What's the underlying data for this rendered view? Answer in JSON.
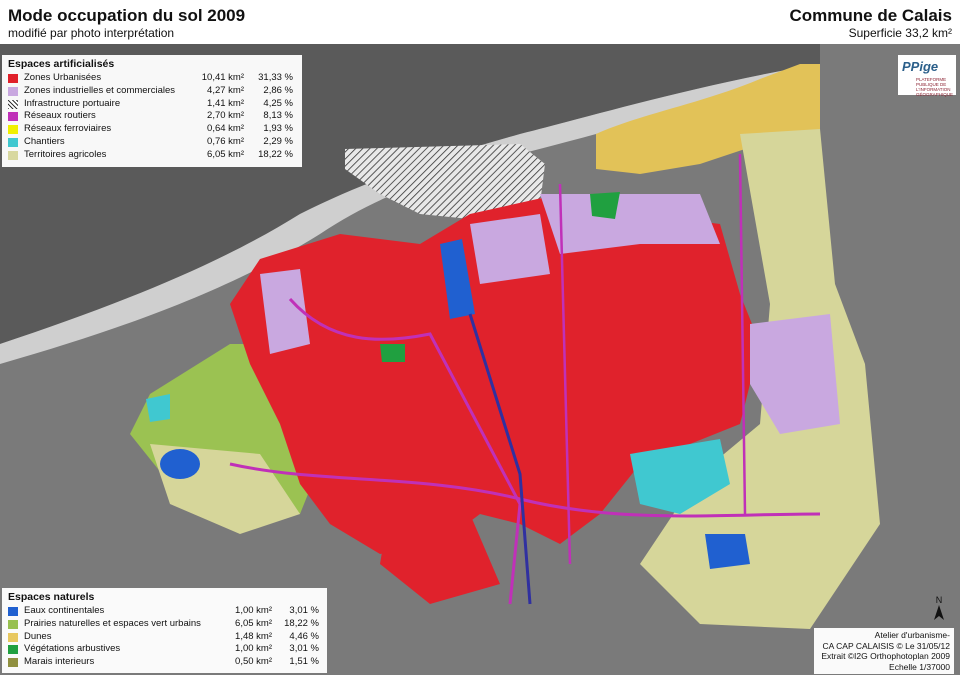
{
  "header": {
    "title": "Mode occupation du sol 2009",
    "subtitle": "modifié par photo interprétation",
    "commune": "Commune de Calais",
    "superficie": "Superficie 33,2 km²"
  },
  "legend_artificial": {
    "heading": "Espaces artificialisés",
    "items": [
      {
        "label": "Zones Urbanisées",
        "area": "10,41 km²",
        "percent": "31,33 %",
        "color": "#e0202a"
      },
      {
        "label": "Zones industrielles et commerciales",
        "area": "4,27 km²",
        "percent": "2,86 %",
        "color": "#c9a8e0"
      },
      {
        "label": "Infrastructure portuaire",
        "area": "1,41 km²",
        "percent": "4,25 %",
        "color": "hatch"
      },
      {
        "label": "Réseaux routiers",
        "area": "2,70 km²",
        "percent": "8,13 %",
        "color": "#c030b8"
      },
      {
        "label": "Réseaux ferroviaires",
        "area": "0,64 km²",
        "percent": "1,93 %",
        "color": "#f0f000"
      },
      {
        "label": "Chantiers",
        "area": "0,76 km²",
        "percent": "2,29 %",
        "color": "#40c8d0"
      },
      {
        "label": "Territoires agricoles",
        "area": "6,05 km²",
        "percent": "18,22 %",
        "color": "#d8d8a0"
      }
    ]
  },
  "legend_natural": {
    "heading": "Espaces naturels",
    "items": [
      {
        "label": "Eaux continentales",
        "area": "1,00 km²",
        "percent": "3,01 %",
        "color": "#2060d0"
      },
      {
        "label": "Prairies naturelles et espaces vert urbains",
        "area": "6,05 km²",
        "percent": "18,22 %",
        "color": "#98c050"
      },
      {
        "label": "Dunes",
        "area": "1,48 km²",
        "percent": "4,46 %",
        "color": "#e8c860"
      },
      {
        "label": "Végétations arbustives",
        "area": "1,00 km²",
        "percent": "3,01 %",
        "color": "#20a040"
      },
      {
        "label": "Marais interieurs",
        "area": "0,50 km²",
        "percent": "1,51 %",
        "color": "#909040"
      }
    ]
  },
  "logo": {
    "mark": "PPige",
    "text": "PLATEFORME PUBLIQUE DE L'INFORMATION GÉOGRAPHIQUE"
  },
  "credits": {
    "line1": "Atelier d'urbanisme-",
    "line2": "CA CAP CALAISIS © Le 31/05/12",
    "line3": "Extrait ©I2G Orthophotoplan 2009",
    "line4": "Echelle 1/37000"
  },
  "north": {
    "label": "N"
  }
}
